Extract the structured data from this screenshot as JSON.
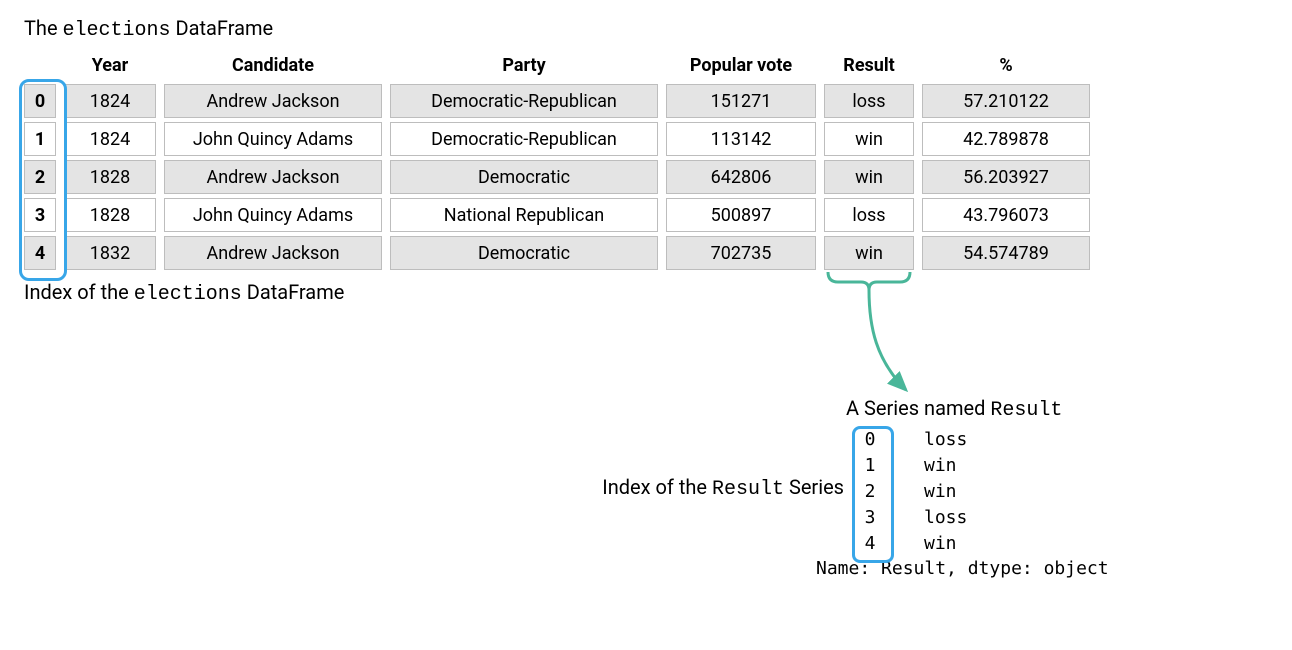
{
  "title_prefix": "The ",
  "title_code": "elections",
  "title_suffix": " DataFrame",
  "index_caption_prefix": "Index of the ",
  "index_caption_code": "elections",
  "index_caption_suffix": " DataFrame",
  "columns": [
    "Year",
    "Candidate",
    "Party",
    "Popular vote",
    "Result",
    "%"
  ],
  "rows": [
    {
      "idx": "0",
      "year": "1824",
      "candidate": "Andrew Jackson",
      "party": "Democratic-Republican",
      "vote": "151271",
      "result": "loss",
      "pct": "57.210122",
      "shaded": true
    },
    {
      "idx": "1",
      "year": "1824",
      "candidate": "John Quincy Adams",
      "party": "Democratic-Republican",
      "vote": "113142",
      "result": "win",
      "pct": "42.789878",
      "shaded": false
    },
    {
      "idx": "2",
      "year": "1828",
      "candidate": "Andrew Jackson",
      "party": "Democratic",
      "vote": "642806",
      "result": "win",
      "pct": "56.203927",
      "shaded": true
    },
    {
      "idx": "3",
      "year": "1828",
      "candidate": "John Quincy Adams",
      "party": "National Republican",
      "vote": "500897",
      "result": "loss",
      "pct": "43.796073",
      "shaded": false
    },
    {
      "idx": "4",
      "year": "1832",
      "candidate": "Andrew Jackson",
      "party": "Democratic",
      "vote": "702735",
      "result": "win",
      "pct": "54.574789",
      "shaded": true
    }
  ],
  "series": {
    "title_prefix": "A Series named ",
    "title_code": "Result",
    "index_label_prefix": "Index of the ",
    "index_label_code": "Result",
    "index_label_suffix": " Series",
    "items": [
      {
        "idx": "0",
        "val": "loss"
      },
      {
        "idx": "1",
        "val": "win"
      },
      {
        "idx": "2",
        "val": "win"
      },
      {
        "idx": "3",
        "val": "loss"
      },
      {
        "idx": "4",
        "val": "win"
      }
    ],
    "footer": "Name: Result, dtype: object"
  },
  "colors": {
    "outline": "#38a6e8",
    "arrow": "#49b699"
  }
}
